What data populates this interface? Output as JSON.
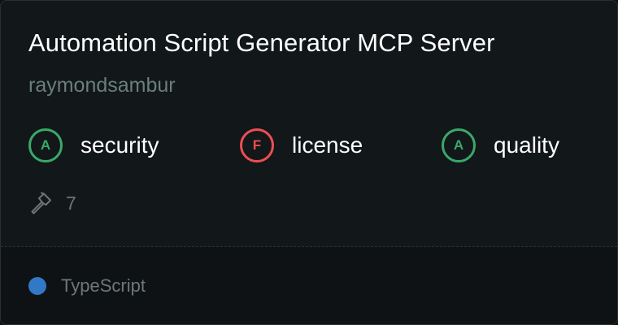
{
  "server": {
    "title": "Automation Script Generator MCP Server",
    "author": "raymondsambur"
  },
  "scores": [
    {
      "grade": "A",
      "label": "security",
      "status": "pass"
    },
    {
      "grade": "F",
      "label": "license",
      "status": "fail"
    },
    {
      "grade": "A",
      "label": "quality",
      "status": "pass"
    }
  ],
  "tools": {
    "icon": "hammer-icon",
    "count": "7"
  },
  "language": {
    "name": "TypeScript",
    "color": "#3178c6"
  },
  "colors": {
    "pass": "#3aa86a",
    "fail": "#ee4d52"
  }
}
